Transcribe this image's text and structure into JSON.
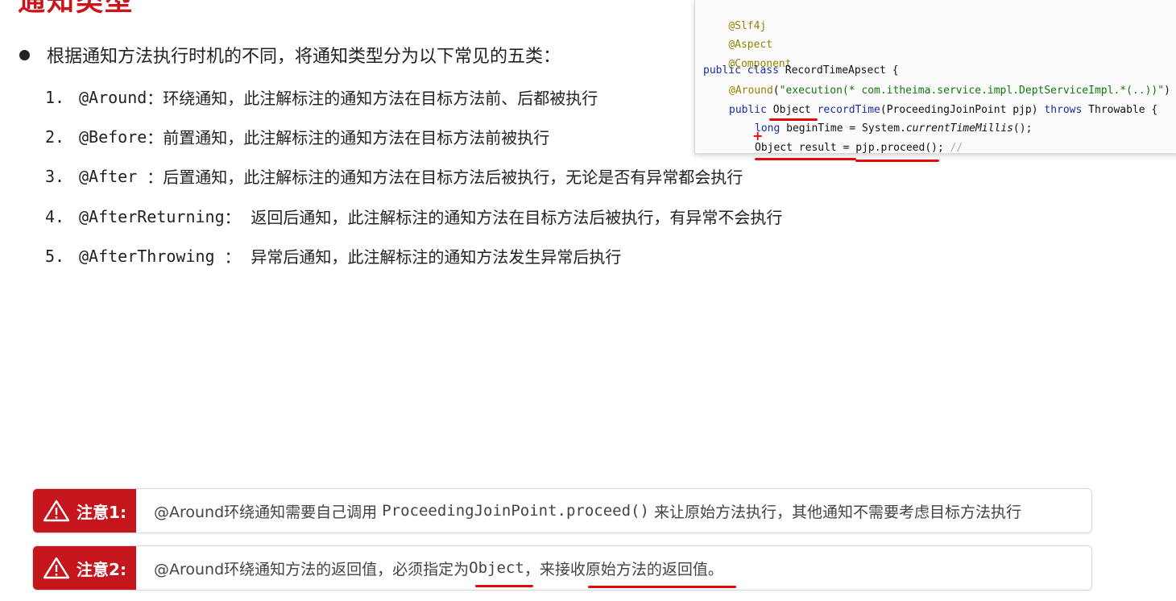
{
  "slide": {
    "title": "通知类型",
    "intro": "根据通知方法执行时机的不同，将通知类型分为以下常见的五类：",
    "items": [
      {
        "num": "1.",
        "annotation": "@Around",
        "sep": "：",
        "desc": "环绕通知，此注解标注的通知方法在目标方法前、后都被执行"
      },
      {
        "num": "2.",
        "annotation": "@Before",
        "sep": "：",
        "desc": "前置通知，此注解标注的通知方法在目标方法前被执行"
      },
      {
        "num": "3.",
        "annotation": "@After ",
        "sep": "：",
        "desc": "后置通知，此注解标注的通知方法在目标方法后被执行，无论是否有异常都会执行"
      },
      {
        "num": "4.",
        "annotation": "@AfterReturning",
        "sep": "：  ",
        "desc": "返回后通知，此注解标注的通知方法在目标方法后被执行，有异常不会执行"
      },
      {
        "num": "5.",
        "annotation": "@AfterThrowing ",
        "sep": "：  ",
        "desc": "异常后通知，此注解标注的通知方法发生异常后执行"
      }
    ]
  },
  "code": {
    "line1": "@Slf4j",
    "line2": "@Aspect",
    "line3": "@Component",
    "line4_kw": "public class",
    "line4_rest": " RecordTimeApsect {",
    "line5_anno": "@Around",
    "line5_open": "(",
    "line5_str": "\"execution(* com.itheima.service.impl.DeptServiceImpl.*(..))\"",
    "line5_close": ")",
    "line6_kw": "public",
    "line6_type": " Object ",
    "line6_method": "recordTime",
    "line6_params": "(ProceedingJoinPoint pjp) ",
    "line6_throws": "throws",
    "line6_end": " Throwable {",
    "line7_kw": "long",
    "line7_rest": " beginTime = System.",
    "line7_call": "currentTimeMillis",
    "line7_end": "();",
    "line8": "Object result = pjp.proceed();",
    "line8_comment": " //"
  },
  "notes": [
    {
      "label": "注意1:",
      "text_a": "@Around环绕通知需要自己调用 ",
      "text_mono": "ProceedingJoinPoint.proceed()",
      "text_b": " 来让原始方法执行，其他通知不需要考虑目标方法执行"
    },
    {
      "label": "注意2:",
      "text_a": "@Around环绕通知方法的返回值，必须指定为",
      "text_mono": "Object",
      "text_b": "，来接收原始方法的返回值。"
    }
  ],
  "colors": {
    "brand_red": "#c5161d",
    "underline_red": "#e00b0b"
  },
  "icons": {
    "warning": "warning-triangle-icon",
    "bullet": "bullet-dot-icon"
  }
}
